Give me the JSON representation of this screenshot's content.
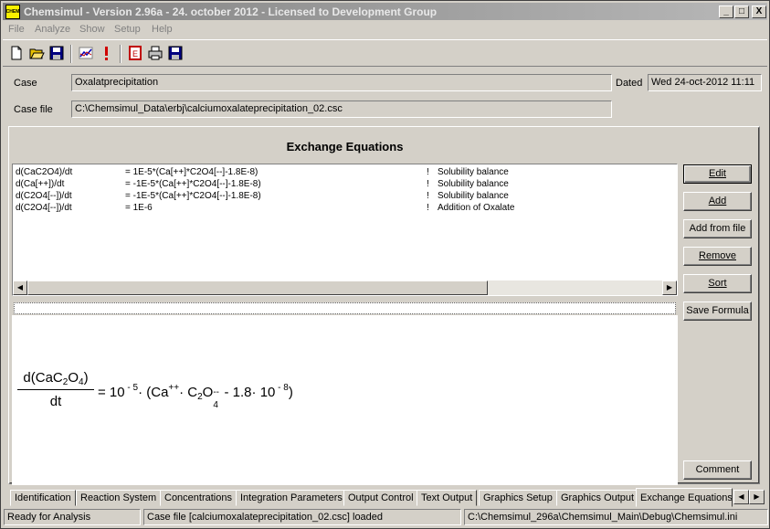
{
  "window": {
    "title": "Chemsimul - Version 2.96a - 24. october 2012 - Licensed to Development Group",
    "icon_label": "CHEM",
    "controls": {
      "minimize": "_",
      "maximize": "□",
      "close": "X"
    }
  },
  "menu": [
    "File",
    "Analyze",
    "Show",
    "Setup",
    "Help"
  ],
  "toolbar": {
    "icons": [
      "new-file-icon",
      "open-folder-icon",
      "save-icon",
      "chart-icon",
      "warning-exclamation-icon",
      "report-icon",
      "print-icon",
      "save-disk-icon"
    ]
  },
  "header": {
    "case_label": "Case",
    "case_value": "Oxalatprecipitation",
    "dated_label": "Dated",
    "dated_value": "Wed 24-oct-2012 11:11",
    "case_file_label": "Case file",
    "case_file_value": "C:\\Chemsimul_Data\\erbj\\calciumoxalateprecipitation_02.csc"
  },
  "panel": {
    "title": "Exchange Equations",
    "equations": [
      {
        "lhs": "d(CaC2O4)/dt",
        "rhs": "= 1E-5*(Ca[++]*C2O4[--]-1.8E-8)",
        "bang": "!",
        "comment": "Solubility balance"
      },
      {
        "lhs": "d(Ca[++])/dt",
        "rhs": "= -1E-5*(Ca[++]*C2O4[--]-1.8E-8)",
        "bang": "!",
        "comment": "Solubility balance"
      },
      {
        "lhs": "d(C2O4[--])/dt",
        "rhs": "= -1E-5*(Ca[++]*C2O4[--]-1.8E-8)",
        "bang": "!",
        "comment": "Solubility balance"
      },
      {
        "lhs": "d(C2O4[--])/dt",
        "rhs": "= 1E-6",
        "bang": "!",
        "comment": "Addition of Oxalate"
      }
    ],
    "formula": {
      "numerator": "d(CaC",
      "num_sub1": "2",
      "num_mid": "O",
      "num_sub2": "4",
      "num_end": ")",
      "denominator": "dt",
      "rhs_a": "= 10",
      "rhs_exp1": " - 5",
      "rhs_b": "· (Ca",
      "rhs_sup_ca": "++",
      "rhs_c": "· C",
      "rhs_sub_c": "2",
      "rhs_d": "O",
      "rhs_sub_o": "4",
      "rhs_sup_o": "--",
      "rhs_e": " - 1.8· 10",
      "rhs_exp2": " - 8",
      "rhs_f": ")"
    },
    "buttons": {
      "edit": "Edit",
      "add": "Add",
      "add_from_file": "Add from file",
      "remove": "Remove",
      "sort": "Sort",
      "save_formula": "Save Formula",
      "comment": "Comment"
    }
  },
  "tabs": [
    "Identification",
    "Reaction System",
    "Concentrations",
    "Integration Parameters",
    "Output Control",
    "Text Output",
    "Graphics Setup",
    "Graphics Output",
    "Exchange Equations"
  ],
  "active_tab": "Exchange Equations",
  "status": {
    "left": "Ready for Analysis",
    "middle": "Case file [calciumoxalateprecipitation_02.csc] loaded",
    "right": "C:\\Chemsimul_296a\\Chemsimul_Main\\Debug\\Chemsimul.ini"
  }
}
